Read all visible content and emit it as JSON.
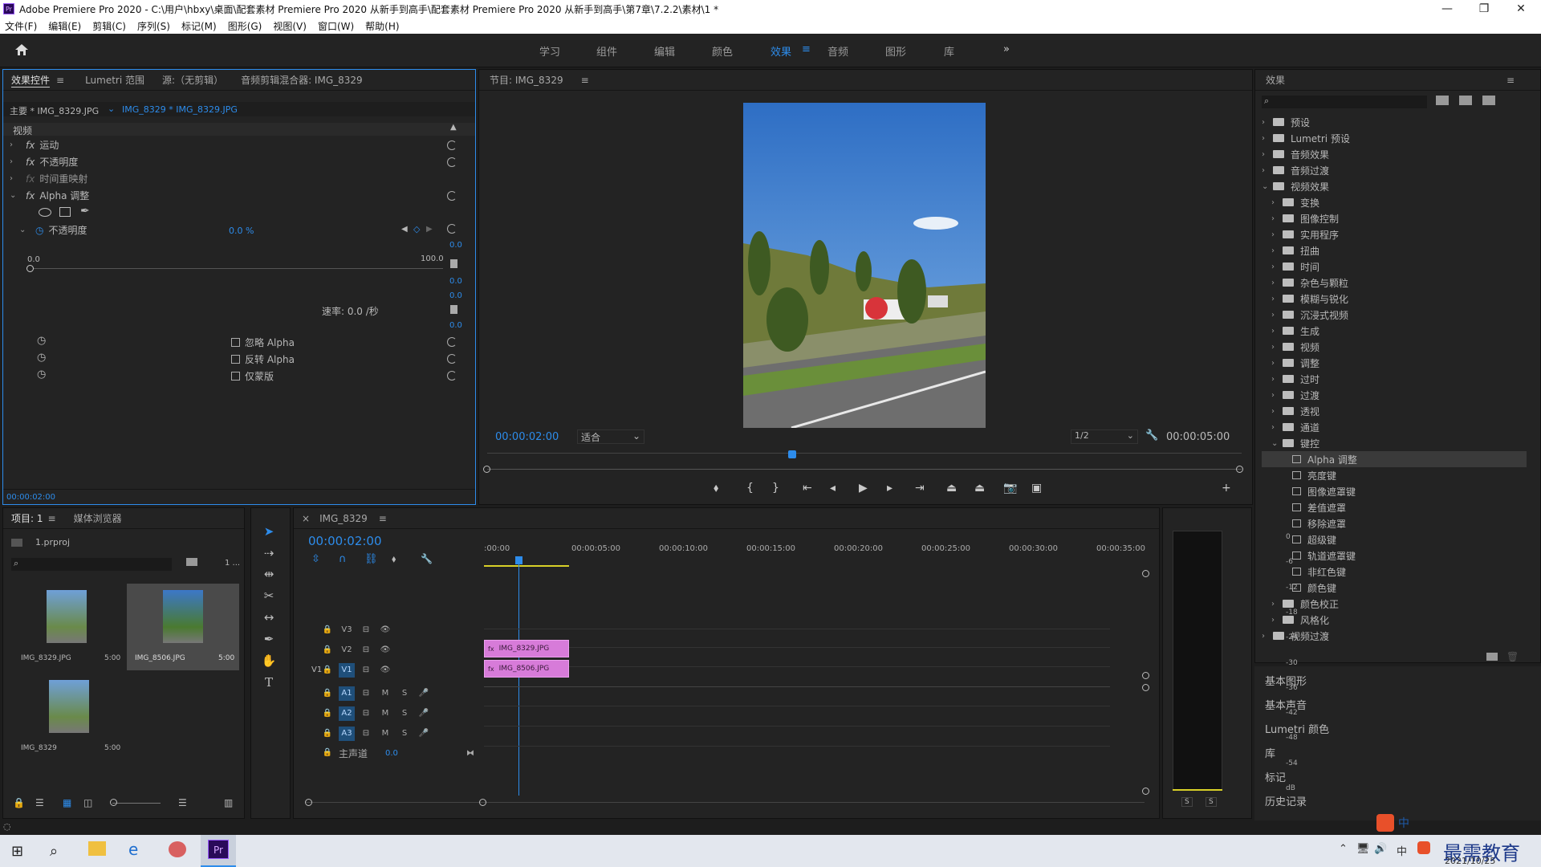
{
  "window": {
    "title": "Adobe Premiere Pro 2020 - C:\\用户\\hbxy\\桌面\\配套素材 Premiere Pro 2020 从新手到高手\\配套素材 Premiere Pro 2020 从新手到高手\\第7章\\7.2.2\\素材\\1 *",
    "minimize": "—",
    "maximize": "❐",
    "close": "✕",
    "logo": "Pr"
  },
  "menu": [
    "文件(F)",
    "编辑(E)",
    "剪辑(C)",
    "序列(S)",
    "标记(M)",
    "图形(G)",
    "视图(V)",
    "窗口(W)",
    "帮助(H)"
  ],
  "workspaces": [
    "学习",
    "组件",
    "编辑",
    "颜色",
    "效果",
    "音频",
    "图形",
    "库"
  ],
  "workspace_active_index": 4,
  "workspace_more": "»",
  "effect_controls": {
    "tabs": [
      "效果控件",
      "Lumetri 范围",
      "源:（无剪辑）",
      "音频剪辑混合器: IMG_8329"
    ],
    "master": "主要 * IMG_8329.JPG",
    "sequence_clip": "IMG_8329 * IMG_8329.JPG",
    "section": "视频",
    "effects": [
      "运动",
      "不透明度",
      "时间重映射",
      "Alpha 调整"
    ],
    "opacity_label": "不透明度",
    "opacity_value": "0.0 %",
    "slider_min": "0.0",
    "slider_max": "100.0",
    "side_values": [
      "0.0",
      "0.0",
      "0.0",
      "0.0"
    ],
    "rate": "速率: 0.0 /秒",
    "checkboxes": [
      "忽略 Alpha",
      "反转 Alpha",
      "仅蒙版"
    ],
    "timecode": "00:00:02:00"
  },
  "program": {
    "title": "节目: IMG_8329",
    "timecode": "00:00:02:00",
    "fit": "适合",
    "resolution": "1/2",
    "duration": "00:00:05:00"
  },
  "effects_panel": {
    "title": "效果",
    "tree": [
      {
        "label": "预设",
        "level": 0,
        "open": false,
        "type": "preset"
      },
      {
        "label": "Lumetri 预设",
        "level": 0,
        "open": false,
        "type": "preset"
      },
      {
        "label": "音频效果",
        "level": 0,
        "open": false,
        "type": "folder"
      },
      {
        "label": "音频过渡",
        "level": 0,
        "open": false,
        "type": "folder"
      },
      {
        "label": "视频效果",
        "level": 0,
        "open": true,
        "type": "folder"
      },
      {
        "label": "变换",
        "level": 1,
        "open": false,
        "type": "folder"
      },
      {
        "label": "图像控制",
        "level": 1,
        "open": false,
        "type": "folder"
      },
      {
        "label": "实用程序",
        "level": 1,
        "open": false,
        "type": "folder"
      },
      {
        "label": "扭曲",
        "level": 1,
        "open": false,
        "type": "folder"
      },
      {
        "label": "时间",
        "level": 1,
        "open": false,
        "type": "folder"
      },
      {
        "label": "杂色与颗粒",
        "level": 1,
        "open": false,
        "type": "folder"
      },
      {
        "label": "模糊与锐化",
        "level": 1,
        "open": false,
        "type": "folder"
      },
      {
        "label": "沉浸式视频",
        "level": 1,
        "open": false,
        "type": "folder"
      },
      {
        "label": "生成",
        "level": 1,
        "open": false,
        "type": "folder"
      },
      {
        "label": "视频",
        "level": 1,
        "open": false,
        "type": "folder"
      },
      {
        "label": "调整",
        "level": 1,
        "open": false,
        "type": "folder"
      },
      {
        "label": "过时",
        "level": 1,
        "open": false,
        "type": "folder"
      },
      {
        "label": "过渡",
        "level": 1,
        "open": false,
        "type": "folder"
      },
      {
        "label": "透视",
        "level": 1,
        "open": false,
        "type": "folder"
      },
      {
        "label": "通道",
        "level": 1,
        "open": false,
        "type": "folder"
      },
      {
        "label": "键控",
        "level": 1,
        "open": true,
        "type": "folder"
      },
      {
        "label": "Alpha 调整",
        "level": 2,
        "type": "effect",
        "selected": true
      },
      {
        "label": "亮度键",
        "level": 2,
        "type": "effect"
      },
      {
        "label": "图像遮罩键",
        "level": 2,
        "type": "effect"
      },
      {
        "label": "差值遮罩",
        "level": 2,
        "type": "effect"
      },
      {
        "label": "移除遮罩",
        "level": 2,
        "type": "effect"
      },
      {
        "label": "超级键",
        "level": 2,
        "type": "effect"
      },
      {
        "label": "轨道遮罩键",
        "level": 2,
        "type": "effect"
      },
      {
        "label": "非红色键",
        "level": 2,
        "type": "effect"
      },
      {
        "label": "颜色键",
        "level": 2,
        "type": "effect"
      },
      {
        "label": "颜色校正",
        "level": 1,
        "open": false,
        "type": "folder"
      },
      {
        "label": "风格化",
        "level": 1,
        "open": false,
        "type": "folder"
      },
      {
        "label": "视频过渡",
        "level": 0,
        "open": false,
        "type": "folder"
      }
    ],
    "side_panels": [
      "基本图形",
      "基本声音",
      "Lumetri 颜色",
      "库",
      "标记",
      "历史记录"
    ]
  },
  "project": {
    "tabs": [
      "项目: 1",
      "媒体浏览器"
    ],
    "file": "1.prproj",
    "count": "1 ...",
    "items": [
      {
        "name": "IMG_8329.JPG",
        "dur": "5:00"
      },
      {
        "name": "IMG_8506.JPG",
        "dur": "5:00"
      },
      {
        "name": "IMG_8329",
        "dur": "5:00"
      }
    ]
  },
  "timeline": {
    "tab": "IMG_8329",
    "timecode": "00:00:02:00",
    "ruler": [
      ":00:00",
      "00:00:05:00",
      "00:00:10:00",
      "00:00:15:00",
      "00:00:20:00",
      "00:00:25:00",
      "00:00:30:00",
      "00:00:35:00"
    ],
    "video_tracks": [
      "V3",
      "V2",
      "V1"
    ],
    "audio_tracks": [
      "A1",
      "A2",
      "A3"
    ],
    "src_patch": "V1",
    "master": "主声道",
    "master_val": "0.0",
    "clips": [
      {
        "track": "V2",
        "name": "IMG_8329.JPG"
      },
      {
        "track": "V1",
        "name": "IMG_8506.JPG"
      }
    ]
  },
  "meter": {
    "scale": [
      "0",
      "-6",
      "-12",
      "-18",
      "-24",
      "-30",
      "-36",
      "-42",
      "-48",
      "-54",
      "dB"
    ],
    "solo": [
      "S",
      "S"
    ]
  },
  "taskbar": {
    "date": "2021/10/25",
    "watermark": "最需教育",
    "ime": "中"
  }
}
